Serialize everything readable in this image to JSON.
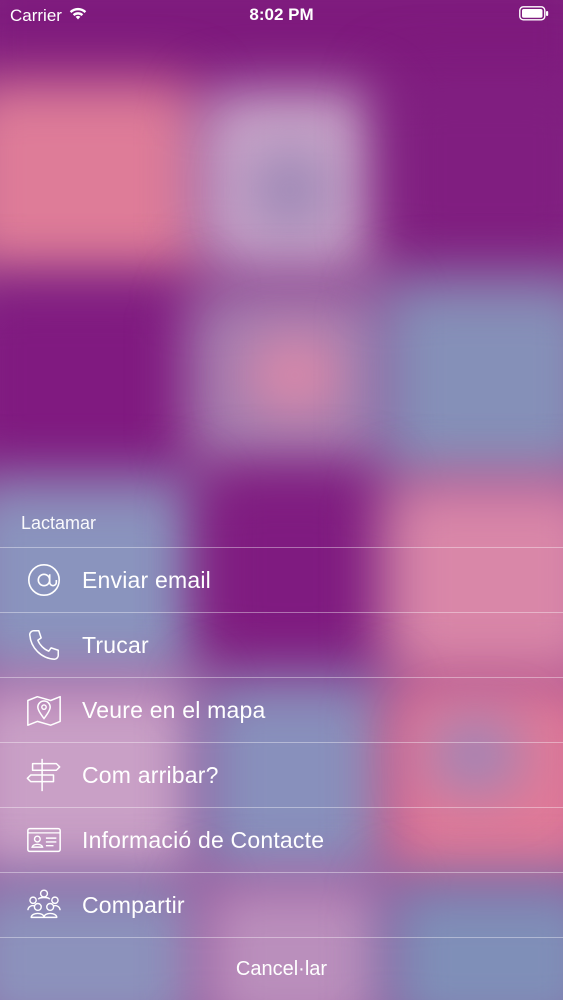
{
  "status_bar": {
    "carrier": "Carrier",
    "time": "8:02 PM",
    "wifi_icon": "wifi-icon",
    "battery_icon": "battery-icon"
  },
  "background": {
    "base_color": "#8a3a8c",
    "accent_colors": [
      "#801b80",
      "#e07a9a",
      "#8a8fb8",
      "#c9a1c9"
    ]
  },
  "sheet": {
    "title": "Lactamar",
    "actions": [
      {
        "label": "Enviar email",
        "icon": "at-sign-icon"
      },
      {
        "label": "Trucar",
        "icon": "phone-icon"
      },
      {
        "label": "Veure en el mapa",
        "icon": "map-pin-icon"
      },
      {
        "label": "Com arribar?",
        "icon": "signpost-icon"
      },
      {
        "label": "Informació de Contacte",
        "icon": "contact-card-icon"
      },
      {
        "label": "Compartir",
        "icon": "people-group-icon"
      }
    ],
    "cancel_label": "Cancel·lar"
  }
}
